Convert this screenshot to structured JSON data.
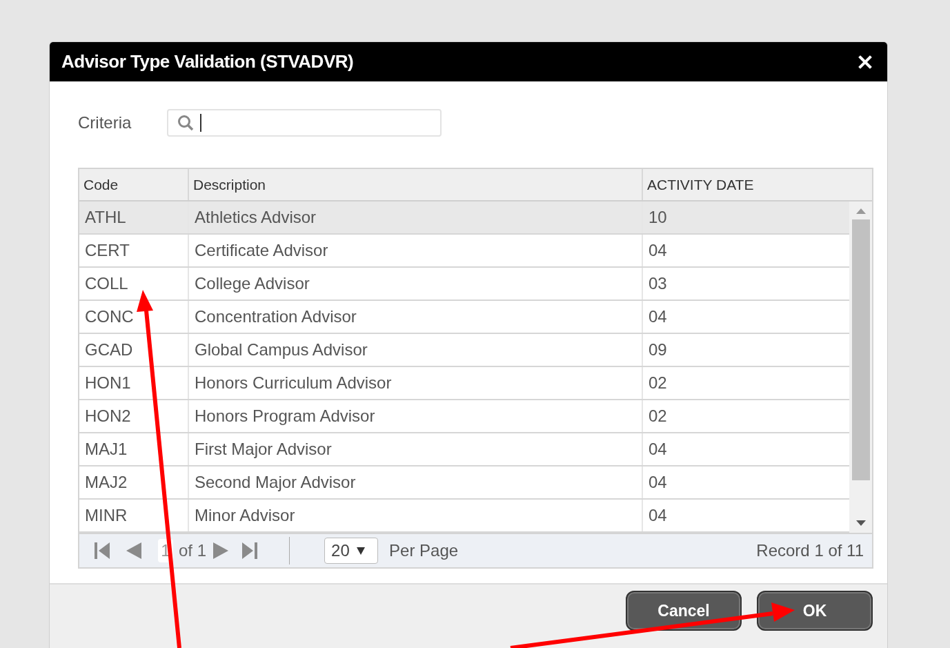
{
  "dialog": {
    "title": "Advisor Type Validation (STVADVR)"
  },
  "criteria": {
    "label": "Criteria"
  },
  "table": {
    "columns": [
      "Code",
      "Description",
      "ACTIVITY DATE"
    ],
    "rows": [
      {
        "code": "ATHL",
        "description": "Athletics Advisor",
        "activity_date": "10",
        "selected": true
      },
      {
        "code": "CERT",
        "description": "Certificate Advisor",
        "activity_date": "04",
        "selected": false
      },
      {
        "code": "COLL",
        "description": "College Advisor",
        "activity_date": "03",
        "selected": false
      },
      {
        "code": "CONC",
        "description": "Concentration Advisor",
        "activity_date": "04",
        "selected": false
      },
      {
        "code": "GCAD",
        "description": "Global Campus Advisor",
        "activity_date": "09",
        "selected": false
      },
      {
        "code": "HON1",
        "description": "Honors Curriculum Advisor",
        "activity_date": "02",
        "selected": false
      },
      {
        "code": "HON2",
        "description": "Honors Program Advisor",
        "activity_date": "02",
        "selected": false
      },
      {
        "code": "MAJ1",
        "description": "First Major Advisor",
        "activity_date": "04",
        "selected": false
      },
      {
        "code": "MAJ2",
        "description": "Second Major Advisor",
        "activity_date": "04",
        "selected": false
      },
      {
        "code": "MINR",
        "description": "Minor Advisor",
        "activity_date": "04",
        "selected": false
      }
    ]
  },
  "pager": {
    "page": "1",
    "of": "of 1",
    "page_size": "20",
    "per_page": "Per Page",
    "record": "Record 1 of 11"
  },
  "buttons": [
    {
      "label": "Cancel"
    },
    {
      "label": "OK"
    }
  ]
}
